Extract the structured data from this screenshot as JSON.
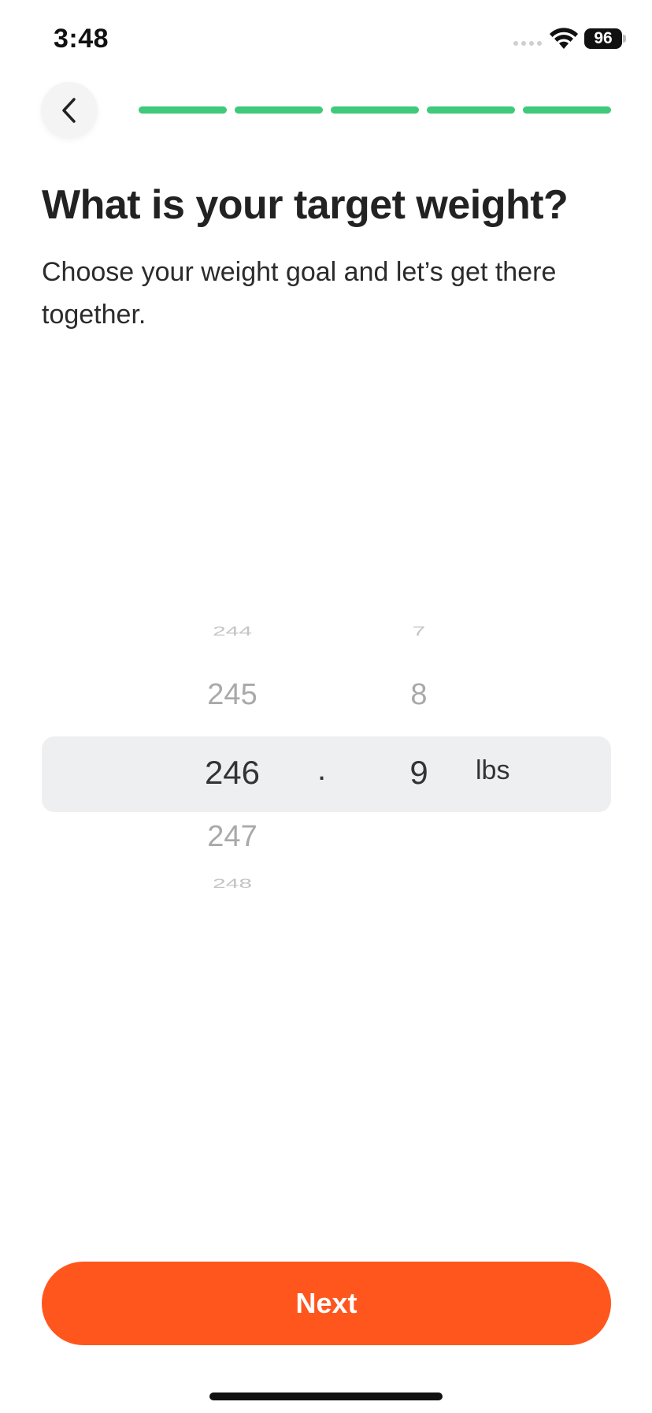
{
  "status_bar": {
    "time": "3:48",
    "battery": "96",
    "icons": [
      "cell-signal-icon",
      "wifi-icon",
      "battery-icon"
    ]
  },
  "header": {
    "back_icon": "chevron-left-icon",
    "progress": {
      "completed": 5,
      "total": 5
    },
    "colors": {
      "progress_done": "#3fc97a"
    }
  },
  "title": "What is your target weight?",
  "subtitle": "Choose your weight goal and let’s get there together.",
  "picker": {
    "integer": {
      "far_above": "244",
      "above": "245",
      "selected": "246",
      "below": "247",
      "far_below": "248"
    },
    "separator": ".",
    "decimal": {
      "far_above": "7",
      "above": "8",
      "selected": "9"
    },
    "unit": "lbs"
  },
  "footer": {
    "next_label": "Next",
    "colors": {
      "accent": "#ff561e"
    }
  }
}
